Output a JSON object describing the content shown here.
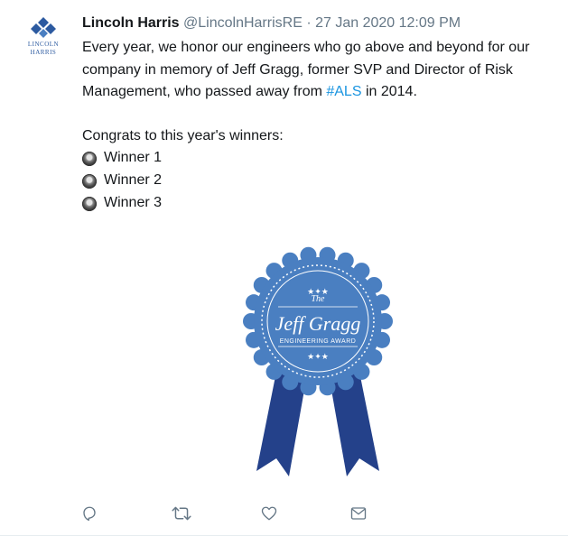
{
  "tweet": {
    "author_name": "Lincoln Harris",
    "handle": "@LincolnHarrisRE",
    "separator": "·",
    "timestamp": "27 Jan 2020 12:09 PM",
    "avatar": {
      "logo_line1": "LINCOLN",
      "logo_line2": "HARRIS",
      "icon": "lincoln-harris-logo",
      "color": "#2c5aa0"
    },
    "text_before_hashtag": "Every year, we honor our engineers who go above and beyond for our company in memory of Jeff Gragg, former SVP and Director of Risk Management, who passed away from ",
    "hashtag": "#ALS",
    "text_after_hashtag": " in 2014.",
    "congrats": "Congrats to this year's winners:",
    "winners": [
      "Winner 1",
      "Winner 2",
      "Winner 3"
    ],
    "badge": {
      "the": "The",
      "name": "Jeff Gragg",
      "subtitle": "ENGINEERING AWARD",
      "color": "#4a7fc1",
      "ribbon_color": "#24418a"
    }
  },
  "actions": {
    "reply_icon": "reply-icon",
    "retweet_icon": "retweet-icon",
    "like_icon": "heart-icon",
    "dm_icon": "envelope-icon",
    "icon_color": "#657786"
  }
}
